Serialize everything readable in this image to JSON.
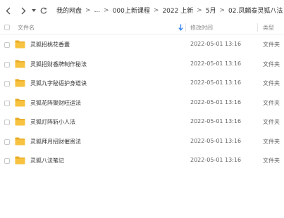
{
  "toolbar": {
    "back_icon": "chevron-left-icon",
    "forward_icon": "chevron-right-icon",
    "history_icon": "dropdown-arrow-icon",
    "refresh_icon": "refresh-icon"
  },
  "breadcrumb": [
    "我的网盘",
    "...",
    "000上新课程",
    "2022 上新",
    "5月",
    "02.凤麟泰灵狐八法"
  ],
  "breadcrumb_separator": ">",
  "columns": {
    "name": "文件名",
    "modified": "修改时间",
    "type": "类型",
    "sort_icon": "sort-down-arrow-icon"
  },
  "files": [
    {
      "name": "灵狐招桃花香囊",
      "modified": "2022-05-01 13:16",
      "type": "文件夹"
    },
    {
      "name": "灵狐招财香牌制作秘法",
      "modified": "2022-05-01 13:16",
      "type": "文件夹"
    },
    {
      "name": "灵狐九字秘语护身道诀",
      "modified": "2022-05-01 13:16",
      "type": "文件夹"
    },
    {
      "name": "灵狐花阵聚财旺运法",
      "modified": "2022-05-01 13:16",
      "type": "文件夹"
    },
    {
      "name": "灵狐灯阵斩小人法",
      "modified": "2022-05-01 13:16",
      "type": "文件夹"
    },
    {
      "name": "灵狐拜月招财催贵法",
      "modified": "2022-05-01 13:16",
      "type": "文件夹"
    },
    {
      "name": "灵狐八法笔记",
      "modified": "2022-05-01 13:16",
      "type": "文件夹"
    }
  ],
  "colors": {
    "folder": "#f7c23f",
    "folder_dark": "#e9ab24",
    "accent": "#2f7ff0"
  }
}
